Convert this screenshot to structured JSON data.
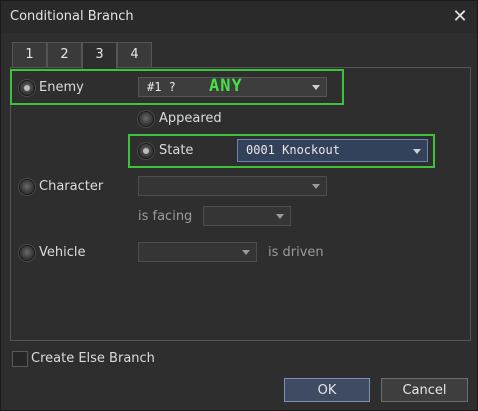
{
  "window": {
    "title": "Conditional Branch",
    "close_glyph": "✕"
  },
  "tabs": [
    {
      "label": "1"
    },
    {
      "label": "2"
    },
    {
      "label": "3",
      "active": true
    },
    {
      "label": "4"
    }
  ],
  "enemy": {
    "label": "Enemy",
    "value": "#1 ?",
    "overlay": "ANY",
    "selected": true
  },
  "appeared": {
    "label": "Appeared"
  },
  "state": {
    "label": "State",
    "value": "0001 Knockout",
    "selected": true
  },
  "character": {
    "label": "Character",
    "value": "",
    "facing_label": "is facing",
    "facing_value": ""
  },
  "vehicle": {
    "label": "Vehicle",
    "value": "",
    "driven_label": "is driven"
  },
  "else_branch": {
    "label": "Create Else Branch",
    "checked": false
  },
  "buttons": {
    "ok": "OK",
    "cancel": "Cancel"
  },
  "colors": {
    "highlight": "#3ec23e",
    "accent": "#3e4b63"
  }
}
